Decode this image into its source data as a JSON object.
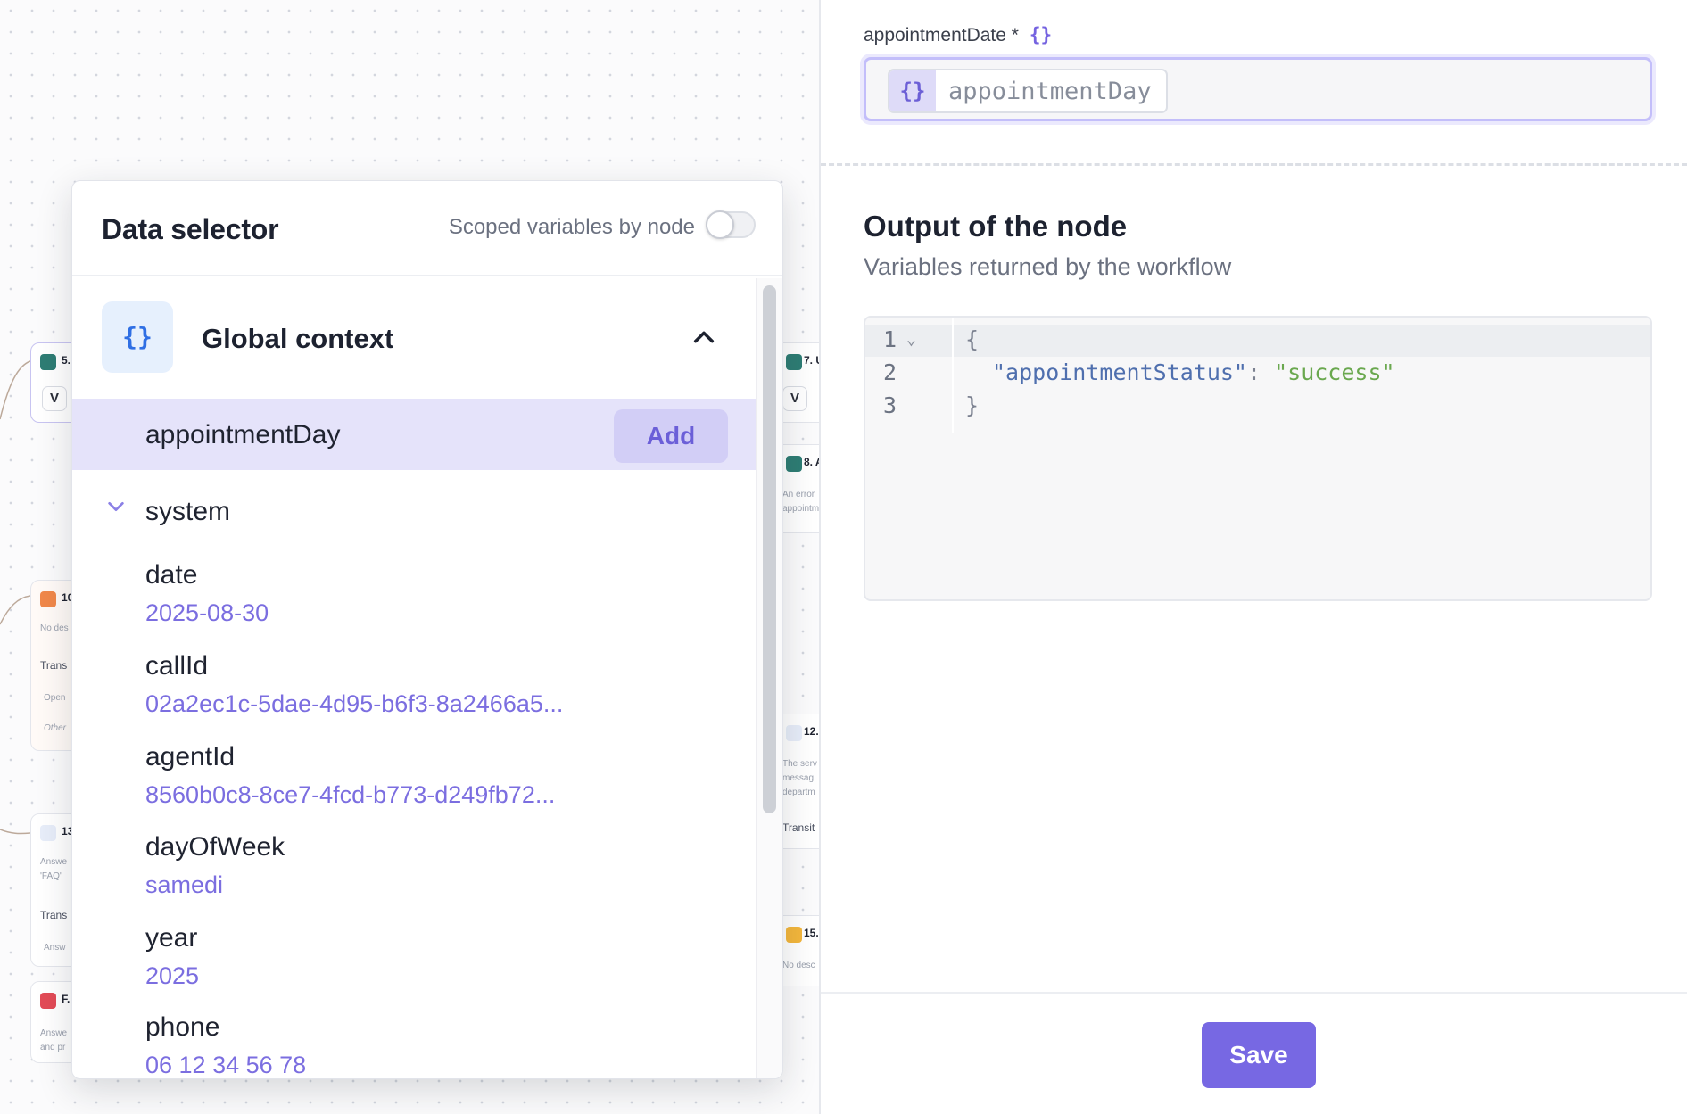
{
  "colors": {
    "accent": "#7768e3",
    "accent_light": "#e5e3fa",
    "value_text": "#7b6ee0",
    "global_icon": "#2f6fe4",
    "json_key": "#4f6fae",
    "json_string": "#6aa84f"
  },
  "canvas": {
    "bg_nodes": [
      {
        "num": "5.",
        "chip": "V"
      },
      {
        "num": "10",
        "line1": "No des",
        "lbl": "Trans",
        "line2": "Open",
        "line3": "Other"
      },
      {
        "num": "13",
        "line1": "Answe",
        "line2": "'FAQ'",
        "lbl": "Trans",
        "line3": "Answ"
      },
      {
        "num": "F.",
        "line1": "Answe",
        "line2": "and pr"
      },
      {
        "num": "7. U",
        "chip": "V"
      },
      {
        "num": "8. A",
        "line1": "An error",
        "line2": "appointm"
      },
      {
        "num": "12.",
        "line1": "The serv",
        "line2": "messag",
        "line3": "departm",
        "lbl": "Transit"
      },
      {
        "num": "15.",
        "line1": "No desc"
      }
    ]
  },
  "data_selector": {
    "title": "Data selector",
    "scoped_label": "Scoped variables by node",
    "scoped_enabled": false,
    "context": {
      "icon": "curly-braces-icon",
      "icon_text": "{}",
      "label": "Global context",
      "expanded": true
    },
    "highlighted_item": {
      "label": "appointmentDay",
      "add_label": "Add"
    },
    "system": {
      "label": "system",
      "items": [
        {
          "key": "date",
          "value": "2025-08-30"
        },
        {
          "key": "callId",
          "value": "02a2ec1c-5dae-4d95-b6f3-8a2466a5..."
        },
        {
          "key": "agentId",
          "value": "8560b0c8-8ce7-4fcd-b773-d249fb72..."
        },
        {
          "key": "dayOfWeek",
          "value": "samedi"
        },
        {
          "key": "year",
          "value": "2025"
        },
        {
          "key": "phone",
          "value": "06 12 34 56 78"
        }
      ]
    }
  },
  "panel": {
    "field": {
      "label": "appointmentDate",
      "required_mark": "*",
      "label_icon": "{}",
      "pill_icon": "{}",
      "pill_text": "appointmentDay"
    },
    "output": {
      "title": "Output of the node",
      "subtitle": "Variables returned by the workflow",
      "code": {
        "line_numbers": [
          "1",
          "2",
          "3"
        ],
        "fold_marker": "⌄",
        "open_brace": "{",
        "key": "\"appointmentStatus\"",
        "colon": ": ",
        "value": "\"success\"",
        "close_brace": "}"
      }
    },
    "save_label": "Save"
  }
}
